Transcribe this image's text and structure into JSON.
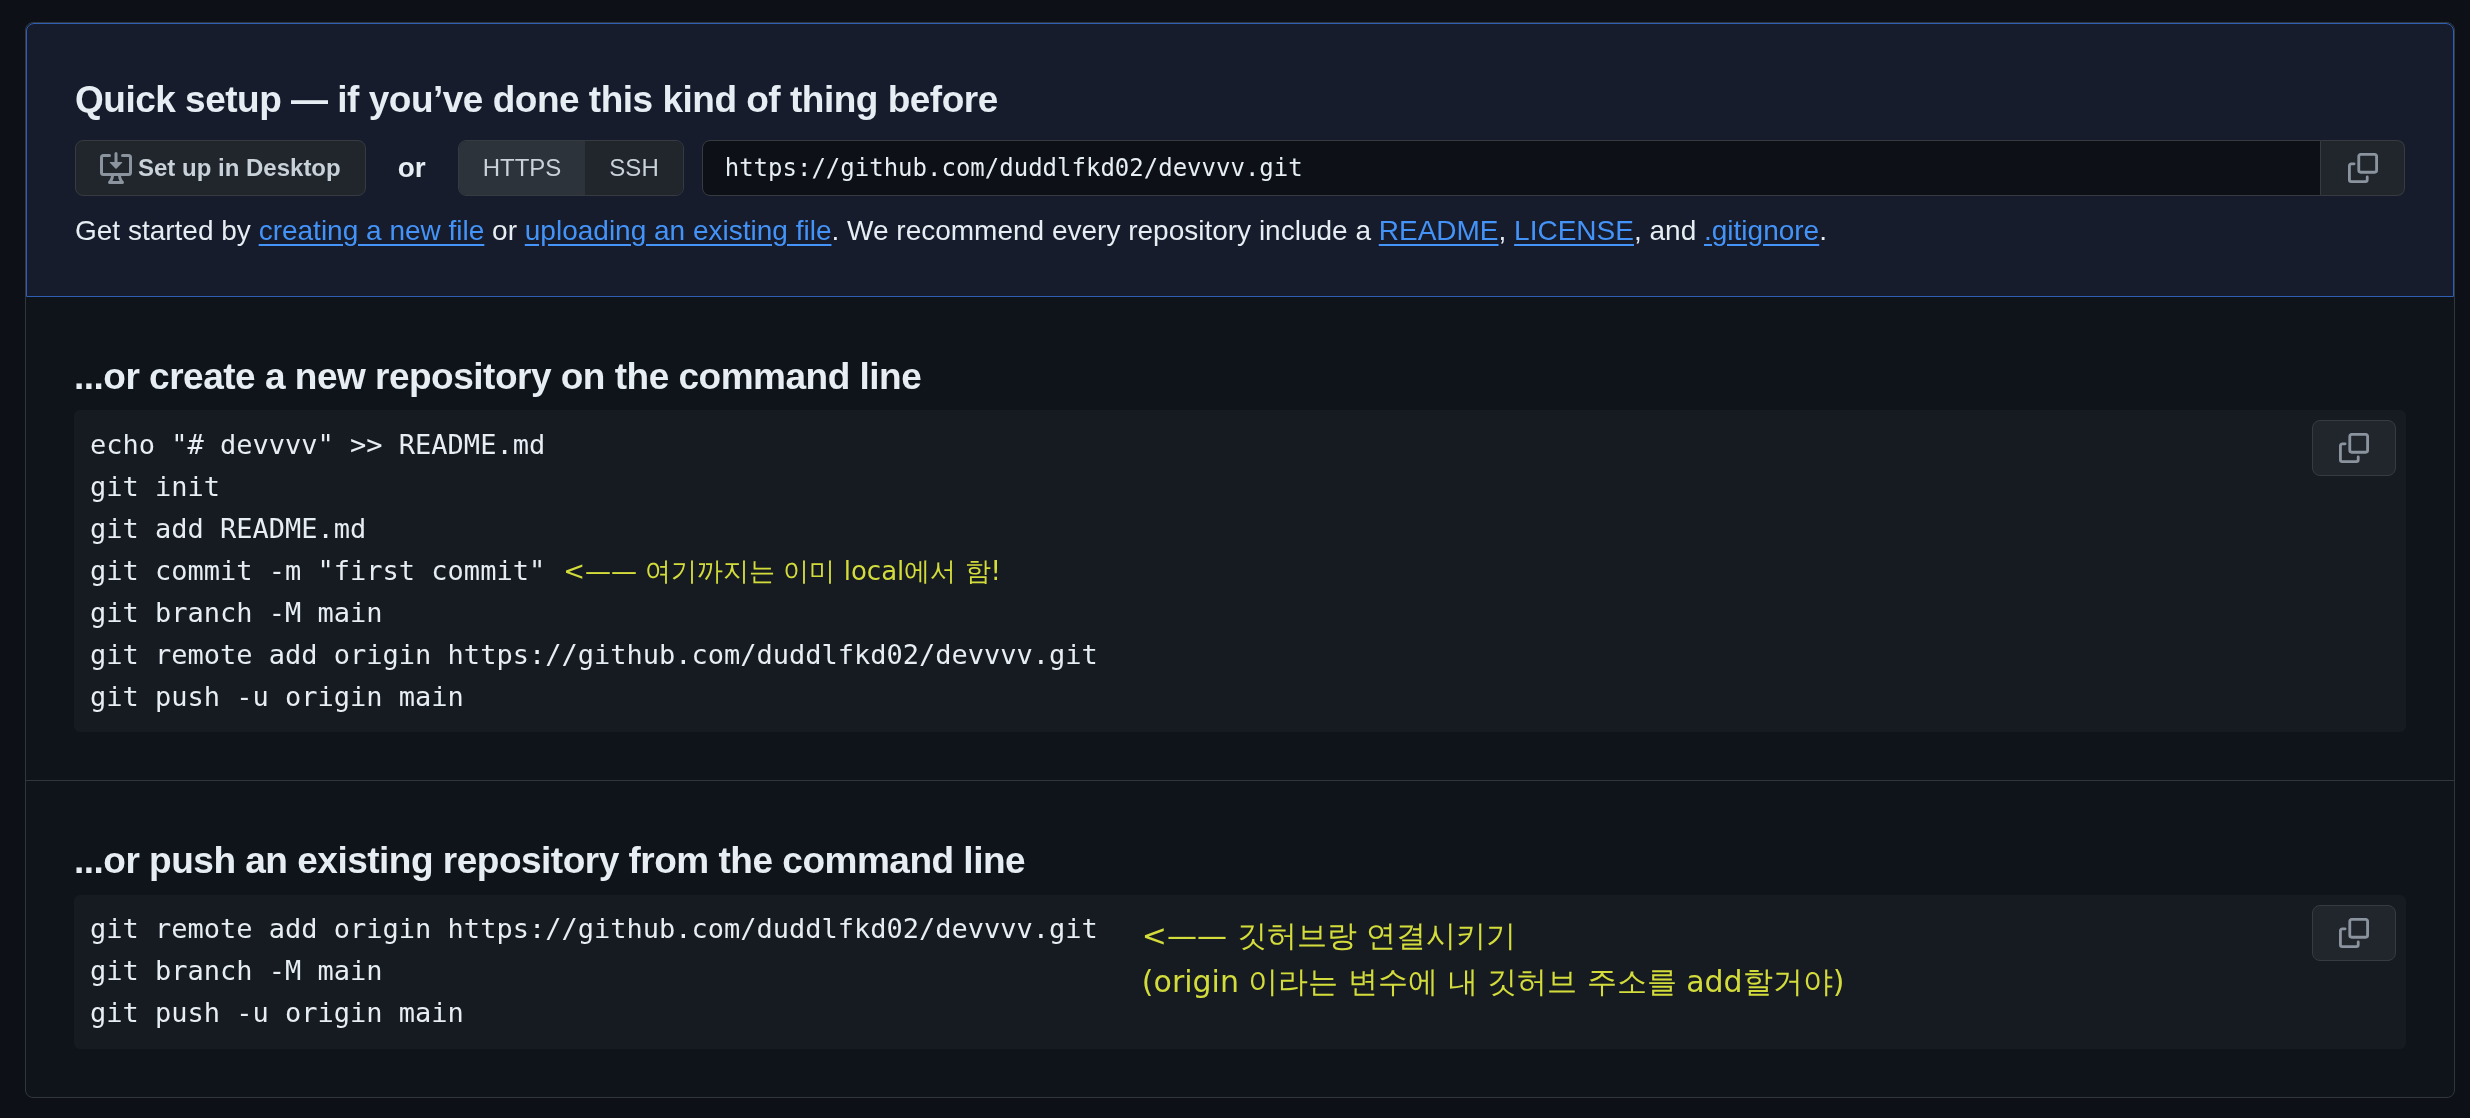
{
  "quick_setup": {
    "title": "Quick setup — if you’ve done this kind of thing before",
    "desktop_button": "Set up in Desktop",
    "or_label": "or",
    "protocols": [
      {
        "label": "HTTPS",
        "selected": true
      },
      {
        "label": "SSH",
        "selected": false
      }
    ],
    "url": "https://github.com/duddlfkd02/devvvv.git",
    "intro": [
      {
        "kind": "text",
        "text": "Get started by "
      },
      {
        "kind": "link",
        "text": "creating a new file"
      },
      {
        "kind": "text",
        "text": " or "
      },
      {
        "kind": "link",
        "text": "uploading an existing file"
      },
      {
        "kind": "text",
        "text": ". We recommend every repository include a "
      },
      {
        "kind": "link",
        "text": "README"
      },
      {
        "kind": "text",
        "text": ", "
      },
      {
        "kind": "link",
        "text": "LICENSE"
      },
      {
        "kind": "text",
        "text": ", and "
      },
      {
        "kind": "link",
        "text": ".gitignore"
      },
      {
        "kind": "text",
        "text": "."
      }
    ]
  },
  "sections": [
    {
      "title": "...or create a new repository on the command line",
      "lines": [
        {
          "code": "echo \"# devvvv\" >> README.md"
        },
        {
          "code": "git init"
        },
        {
          "code": "git add README.md"
        },
        {
          "code": "git commit -m \"first commit\"",
          "note": "<—— 여기까지는 이미 local에서 함!"
        },
        {
          "code": "git branch -M main"
        },
        {
          "code": "git remote add origin https://github.com/duddlfkd02/devvvv.git"
        },
        {
          "code": "git push -u origin main"
        }
      ]
    },
    {
      "title": "...or push an existing repository from the command line",
      "lines": [
        {
          "code": "git remote add origin https://github.com/duddlfkd02/devvvv.git"
        },
        {
          "code": "git branch -M main"
        },
        {
          "code": "git push -u origin main"
        }
      ],
      "annotation": [
        "<—— 깃허브랑 연결시키기",
        "(origin 이라는 변수에 내 깃허브 주소를 add할거야)"
      ]
    }
  ]
}
